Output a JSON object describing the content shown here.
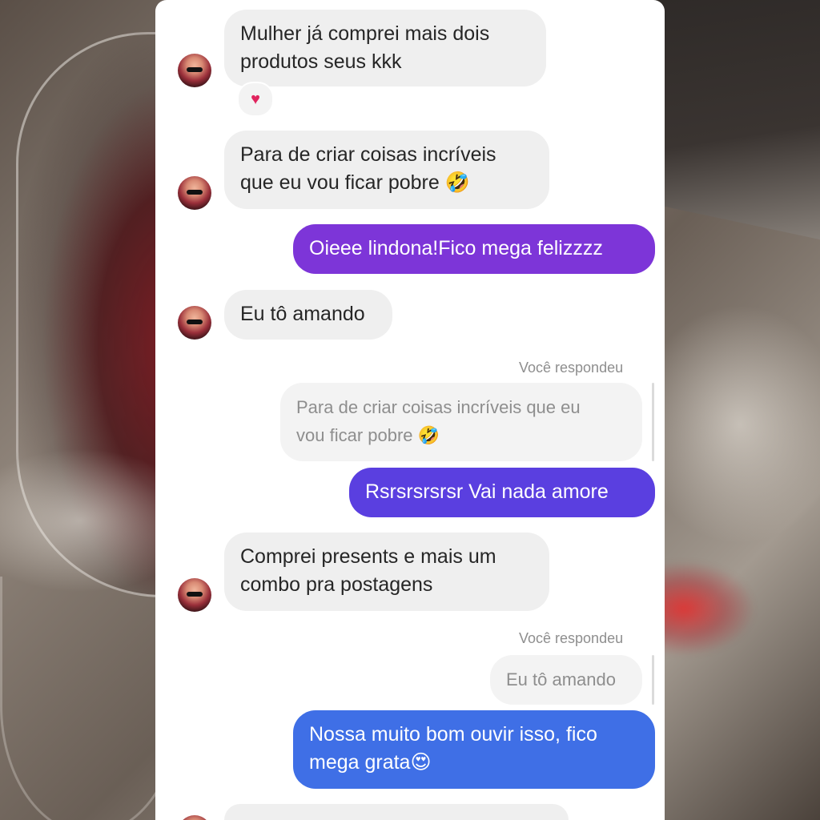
{
  "colors": {
    "bubble_in": "#efefef",
    "bubble_out_1": "#7d35d8",
    "bubble_out_2": "#5a3fe0",
    "bubble_out_3": "#3f6fe6",
    "quote_text": "#8e8e8e"
  },
  "messages": [
    {
      "from": "contact",
      "text": "Mulher já comprei mais dois\nprodutos seus kkk",
      "reaction": "♥"
    },
    {
      "from": "contact",
      "text": "Para de criar coisas incríveis\nque eu vou ficar pobre 🤣"
    },
    {
      "from": "me",
      "text": "Oieee lindona!Fico mega felizzzz"
    },
    {
      "from": "contact",
      "text": "Eu tô amando"
    },
    {
      "from": "me",
      "reply_label": "Você respondeu",
      "quoted": "Para de criar coisas incríveis que eu\nvou ficar pobre 🤣",
      "text": "Rsrsrsrsrsr Vai nada amore"
    },
    {
      "from": "contact",
      "text": "Comprei presents e mais um\ncombo pra postagens"
    },
    {
      "from": "me",
      "reply_label": "Você respondeu",
      "quoted": "Eu tô amando",
      "text": "Nossa muito bom ouvir isso, fico\nmega grata😍"
    }
  ],
  "icons": {
    "avatar": "contact-avatar",
    "reaction": "heart-icon"
  }
}
